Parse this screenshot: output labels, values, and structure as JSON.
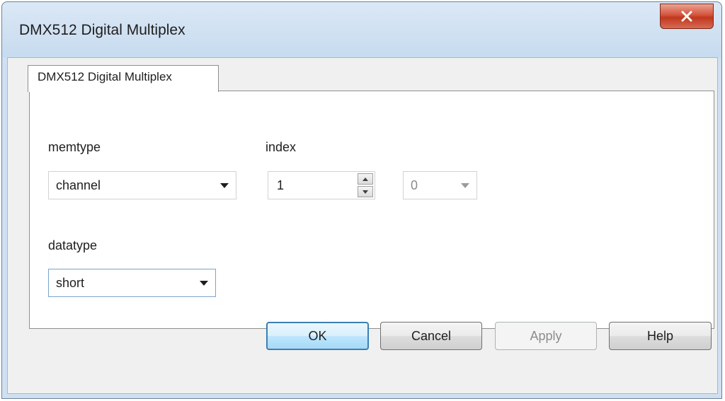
{
  "window": {
    "title": "DMX512 Digital Multiplex",
    "close_icon": "close-x-icon",
    "close_color": "#c7432a"
  },
  "tabs": [
    {
      "label": "DMX512 Digital Multiplex",
      "active": true
    }
  ],
  "form": {
    "memtype": {
      "label": "memtype",
      "value": "channel"
    },
    "index": {
      "label": "index",
      "value": "1"
    },
    "subindex": {
      "value": "0",
      "enabled": false
    },
    "datatype": {
      "label": "datatype",
      "value": "short"
    }
  },
  "buttons": {
    "ok": "OK",
    "cancel": "Cancel",
    "apply": "Apply",
    "help": "Help"
  }
}
